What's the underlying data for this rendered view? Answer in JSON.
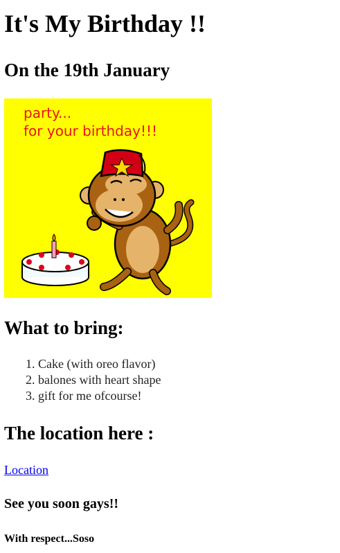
{
  "header": {
    "title": "It's My Birthday !!",
    "date": "On the 19th January"
  },
  "card": {
    "line1": "party...",
    "line2": "for your birthday!!!",
    "background": "#ffff00",
    "text_color": "#e5161f"
  },
  "bring": {
    "heading": "What to bring:",
    "items": [
      "Cake (with oreo flavor)",
      "balones with heart shape",
      "gift for me ofcourse!"
    ]
  },
  "location": {
    "heading": "The location here :",
    "link_label": "Location",
    "link_color": "#0000ee"
  },
  "footer": {
    "see_you": "See you soon gays!!",
    "signature": "With respect...Soso"
  }
}
